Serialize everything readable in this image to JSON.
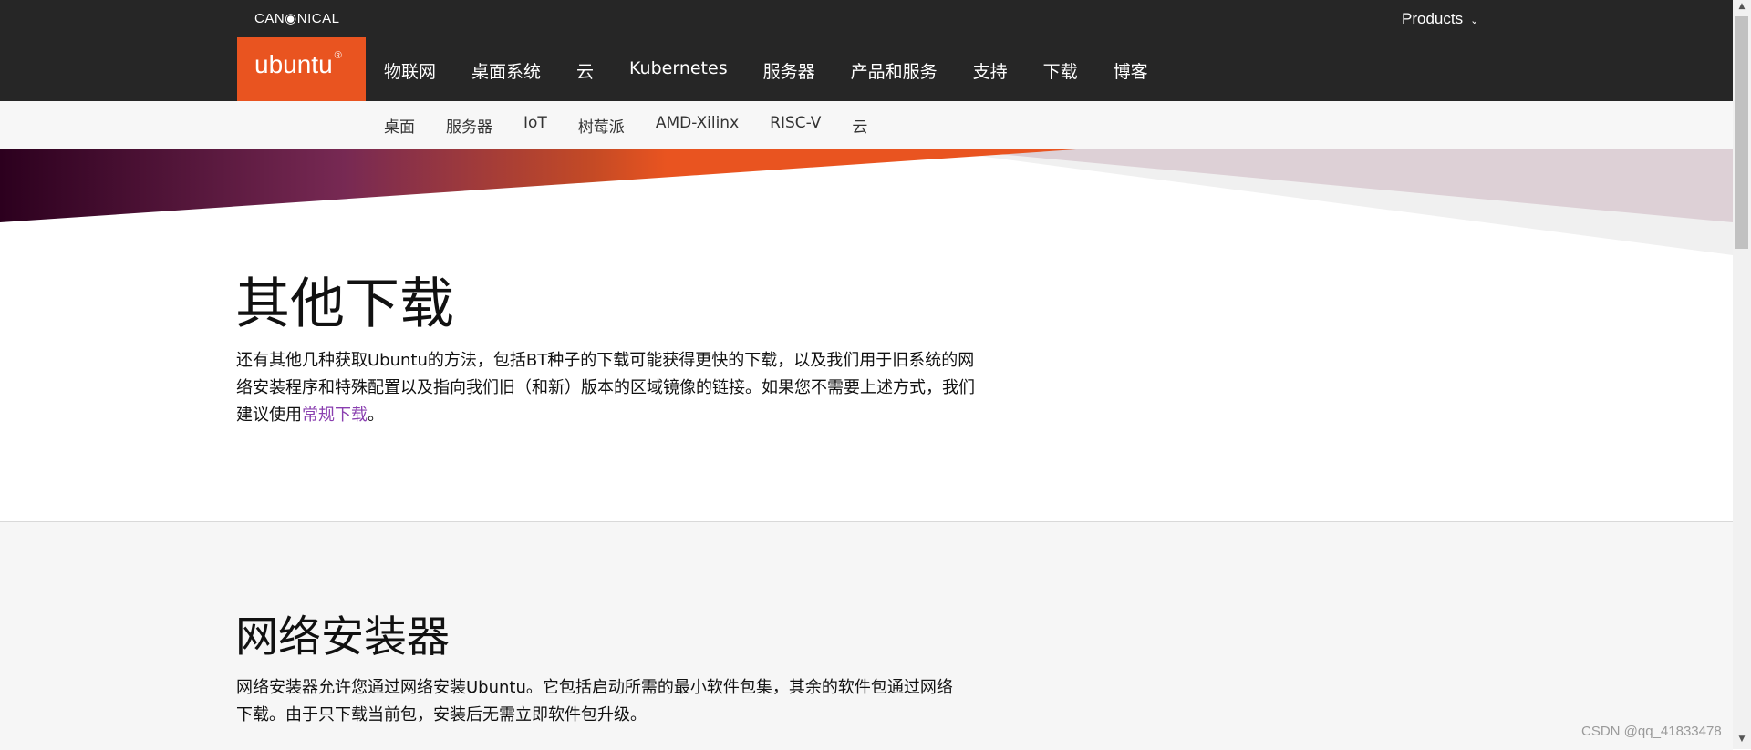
{
  "topbar": {
    "canonical": "CAN◉NICAL",
    "products_label": "Products",
    "products_chevron": "chevron-down-icon"
  },
  "brand": {
    "logo": "ubuntu",
    "logo_mark": "®",
    "section": "下载"
  },
  "main_nav": [
    "物联网",
    "桌面系统",
    "云",
    "Kubernetes",
    "服务器",
    "产品和服务",
    "支持",
    "下载",
    "博客"
  ],
  "sub_nav": [
    "桌面",
    "服务器",
    "IoT",
    "树莓派",
    "AMD-Xilinx",
    "RISC-V",
    "云"
  ],
  "colors": {
    "accent": "#e95420",
    "topbar": "#262626",
    "aubergine": "#2c001e"
  },
  "section1": {
    "title": "其他下载",
    "text_before": "还有其他几种获取Ubuntu的方法，包括BT种子的下载可能获得更快的下载，以及我们用于旧系统的网络安装程序和特殊配置以及指向我们旧（和新）版本的区域镜像的链接。如果您不需要上述方式，我们建议使用",
    "link": "常规下载",
    "text_after": "。"
  },
  "section2": {
    "title": "网络安装器",
    "text": "网络安装器允许您通过网络安装Ubuntu。它包括启动所需的最小软件包集，其余的软件包通过网络下载。由于只下载当前包，安装后无需立即软件包升级。"
  },
  "watermark": "CSDN @qq_41833478"
}
